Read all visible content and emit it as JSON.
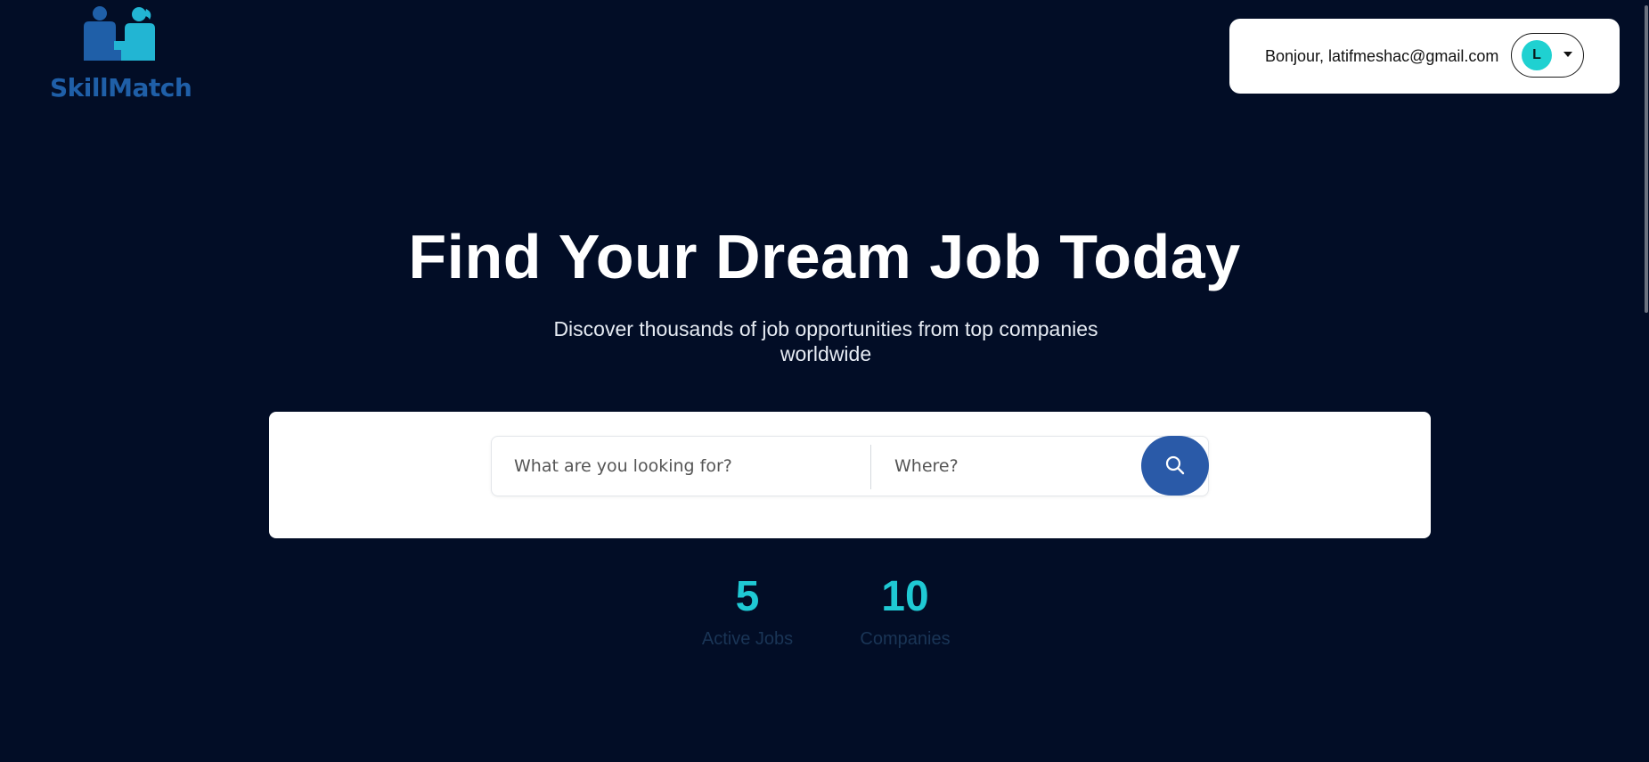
{
  "header": {
    "logo_text": "SkillMatch",
    "greeting": "Bonjour, latifmeshac@gmail.com",
    "avatar_initial": "L"
  },
  "hero": {
    "title": "Find Your Dream Job Today",
    "subtitle": "Discover thousands of job opportunities from top companies worldwide"
  },
  "search": {
    "what_placeholder": "What are you looking for?",
    "where_placeholder": "Where?",
    "button_icon": "search-icon"
  },
  "stats": [
    {
      "value": "5",
      "label": "Active Jobs"
    },
    {
      "value": "10",
      "label": "Companies"
    }
  ],
  "colors": {
    "background": "#020d26",
    "accent": "#1fc9d4",
    "brand": "#1f5fa8",
    "search_button": "#2a5aa8"
  }
}
